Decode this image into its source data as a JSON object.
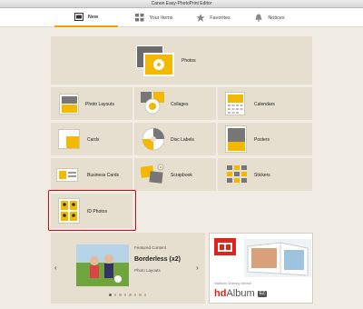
{
  "window": {
    "title": "Canon Easy-PhotoPrint Editor"
  },
  "tabs": [
    {
      "label": "New",
      "icon": "new-icon"
    },
    {
      "label": "Your Items",
      "icon": "grid-icon"
    },
    {
      "label": "Favorites",
      "icon": "star-icon"
    },
    {
      "label": "Notices",
      "icon": "bell-icon"
    }
  ],
  "categories": {
    "photos": "Photos",
    "photo_layouts": "Photo Layouts",
    "collages": "Collages",
    "calendars": "Calendars",
    "cards": "Cards",
    "disc_labels": "Disc Labels",
    "posters": "Posters",
    "business_cards": "Business Cards",
    "scrapbook": "Scrapbook",
    "stickers": "Stickers",
    "id_photos": "ID Photos"
  },
  "featured": {
    "heading": "Featured Content",
    "title": "Borderless (x2)",
    "subtitle": "Photo Layouts",
    "page_count": 8,
    "active_page": 1
  },
  "promo": {
    "caption": "hdAlbum Ordering Service",
    "logo_main": "hd",
    "logo_word": "Album",
    "logo_badge": "EZ"
  },
  "colors": {
    "accent": "#f0a400",
    "highlight": "#e60012",
    "tile": "#e6dfcf",
    "background": "#f1ece4"
  }
}
